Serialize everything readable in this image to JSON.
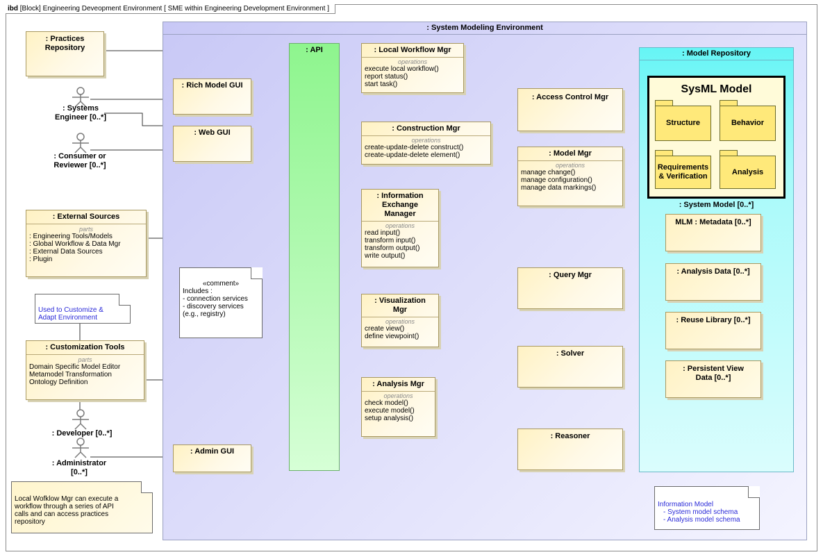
{
  "frame": {
    "kind": "ibd",
    "title": "[Block] Engineering Deveopment Environment [ SME within Engineering Development Environment ]"
  },
  "environment": {
    "title": ": System Modeling Environment"
  },
  "api": {
    "title": ": API"
  },
  "external": {
    "practices": {
      "title": ": Practices Repository"
    },
    "external_sources": {
      "title": ": External Sources",
      "keyword": "parts",
      "items": [
        ": Engineering Tools/Models",
        ": Global Workflow & Data Mgr",
        ": External Data Sources",
        ": Plugin"
      ]
    },
    "customization_tools": {
      "title": ": Customization Tools",
      "keyword": "parts",
      "items": [
        "Domain Specific Model Editor",
        "Metamodel Transformation",
        "Ontology Definition"
      ]
    }
  },
  "actors": {
    "systems_engineer": ": Systems Engineer [0..*]",
    "consumer": ": Consumer or Reviewer [0..*]",
    "developer": ": Developer [0..*]",
    "administrator": ": Administrator [0..*]"
  },
  "guis": {
    "rich": ": Rich Model GUI",
    "web": ": Web GUI",
    "admin": ": Admin GUI"
  },
  "managers": {
    "local_workflow": {
      "title": ": Local Workflow Mgr",
      "keyword": "operations",
      "ops": [
        "execute local workflow()",
        "report status()",
        "start task()"
      ]
    },
    "construction": {
      "title": ": Construction Mgr",
      "keyword": "operations",
      "ops": [
        "create-update-delete  construct()",
        "create-update-delete element()"
      ]
    },
    "information_exchange": {
      "title_lines": [
        ": Information",
        "Exchange",
        "Manager"
      ],
      "keyword": "operations",
      "ops": [
        "read input()",
        "transform input()",
        "transform output()",
        "write output()"
      ]
    },
    "visualization": {
      "title_lines": [
        ": Visualization",
        "Mgr"
      ],
      "keyword": "operations",
      "ops": [
        "create view()",
        "define viewpoint()"
      ]
    },
    "analysis": {
      "title": ": Analysis Mgr",
      "keyword": "operations",
      "ops": [
        "check model()",
        "execute model()",
        "setup analysis()"
      ]
    },
    "access_control": {
      "title": ": Access Control Mgr"
    },
    "model_mgr": {
      "title": ": Model Mgr",
      "keyword": "operations",
      "ops": [
        "manage change()",
        "manage configuration()",
        "manage data markings()"
      ]
    },
    "query": {
      "title": ": Query Mgr"
    },
    "solver": {
      "title": ": Solver"
    },
    "reasoner": {
      "title": ": Reasoner"
    }
  },
  "repository": {
    "title": ": Model Repository",
    "sysml": {
      "title": "SysML Model",
      "packages": [
        "Structure",
        "Behavior",
        "Requirements & Verification",
        "Analysis"
      ]
    },
    "system_model": ": System Model [0..*]",
    "parts": [
      "MLM : Metadata [0..*]",
      ": Analysis Data [0..*]",
      ": Reuse Library [0..*]",
      ": Persistent View Data [0..*]"
    ]
  },
  "notes": {
    "comment": {
      "stereotype": "«comment»",
      "lines": [
        "Includes :",
        "- connection services",
        "- discovery services",
        "(e.g., registry)"
      ]
    },
    "customize": [
      "Used to Customize &",
      "Adapt Environment"
    ],
    "local_workflow_note": [
      "Local Wofklow  Mgr can execute a",
      "workflow through a series of API",
      "calls and can access practices",
      "repository"
    ],
    "information_model": {
      "title": "Information Model",
      "items": [
        "-  System model schema",
        "-  Analysis model schema"
      ]
    }
  }
}
